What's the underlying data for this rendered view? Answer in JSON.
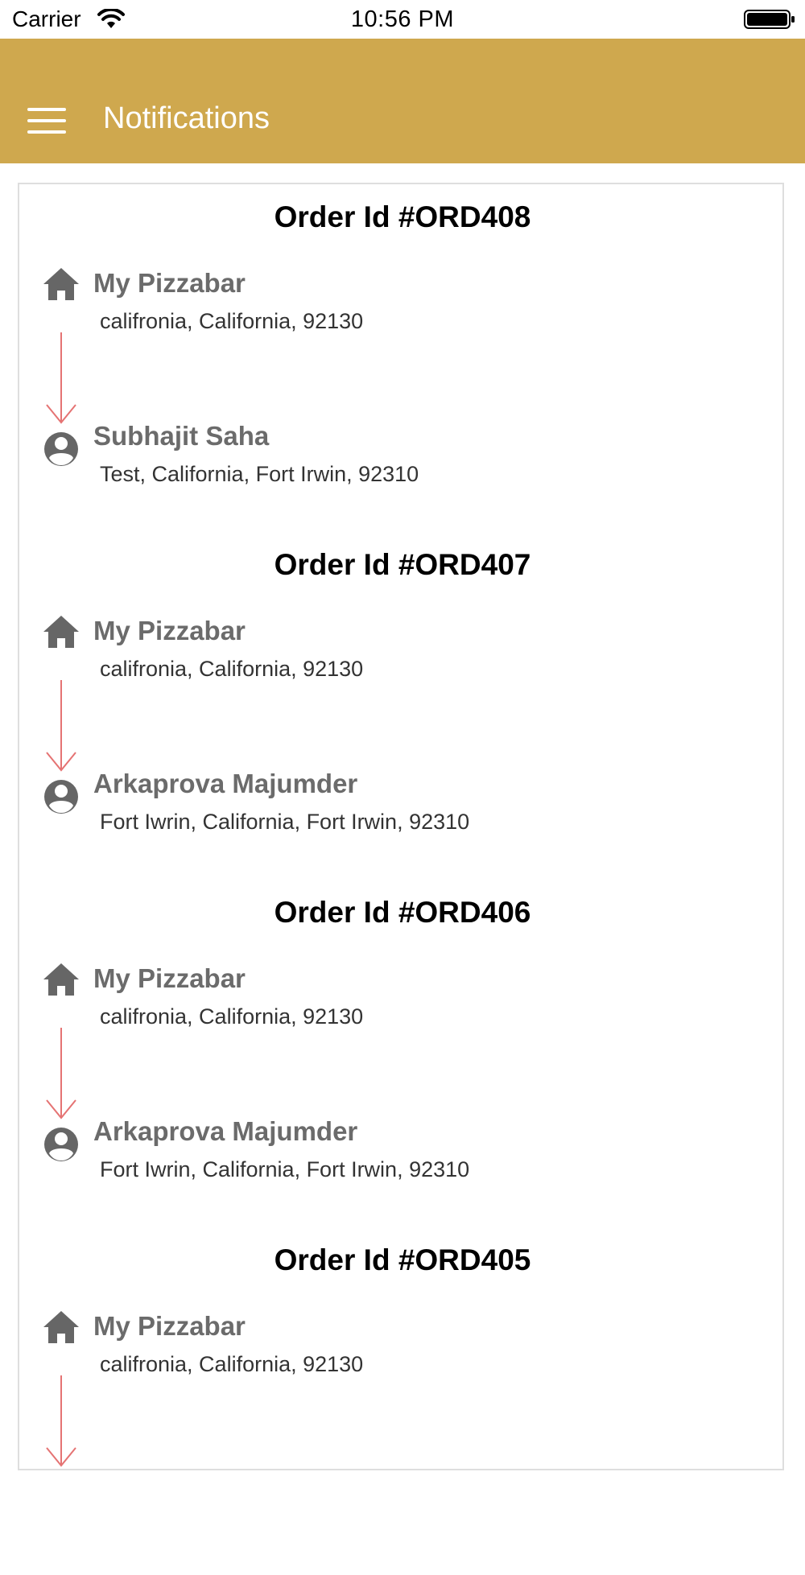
{
  "status_bar": {
    "carrier": "Carrier",
    "time": "10:56 PM"
  },
  "header": {
    "title": "Notifications",
    "background": "#cfa84e"
  },
  "colors": {
    "arrow": "#e57373",
    "icon": "#666666"
  },
  "orders": [
    {
      "title": "Order Id #ORD408",
      "from_name": "My Pizzabar",
      "from_address": "califronia, California, 92130",
      "to_name": "Subhajit Saha",
      "to_address": "Test, California, Fort Irwin, 92310"
    },
    {
      "title": "Order Id #ORD407",
      "from_name": "My Pizzabar",
      "from_address": "califronia, California, 92130",
      "to_name": "Arkaprova Majumder",
      "to_address": "Fort Iwrin, California, Fort Irwin, 92310"
    },
    {
      "title": "Order Id #ORD406",
      "from_name": "My Pizzabar",
      "from_address": "califronia, California, 92130",
      "to_name": "Arkaprova Majumder",
      "to_address": "Fort Iwrin, California, Fort Irwin, 92310"
    },
    {
      "title": "Order Id #ORD405",
      "from_name": "My Pizzabar",
      "from_address": "califronia, California, 92130"
    }
  ]
}
